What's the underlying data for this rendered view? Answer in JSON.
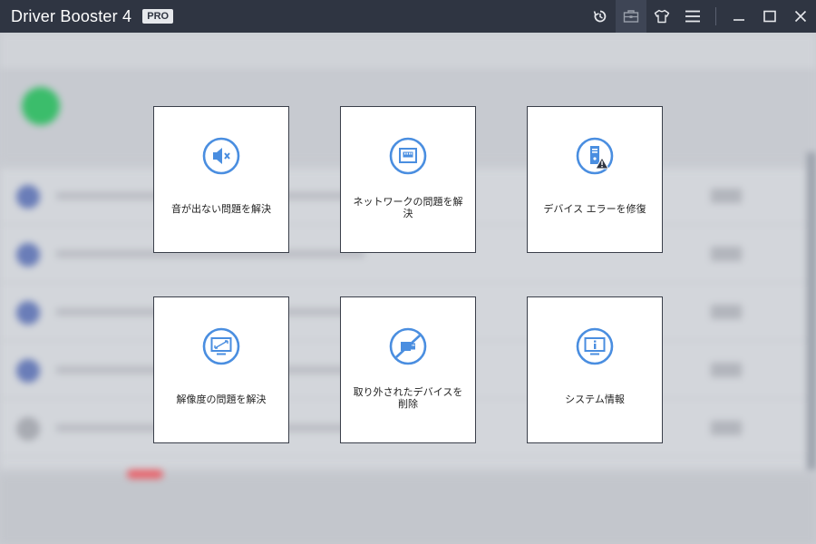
{
  "window": {
    "title": "Driver Booster 4",
    "badge": "PRO"
  },
  "titlebar_icons": [
    "restore-icon",
    "toolbox-icon",
    "skin-icon",
    "menu-icon",
    "minimize-icon",
    "maximize-icon",
    "close-icon"
  ],
  "colors": {
    "accent": "#4a8ee0",
    "titlebar": "#2f3542",
    "card_bg": "#ffffff",
    "warning": "#2f3542"
  },
  "tools": [
    {
      "label": "音が出ない問題を解決",
      "icon": "mute-speaker-icon"
    },
    {
      "label": "ネットワークの問題を解決",
      "icon": "network-port-icon"
    },
    {
      "label": "デバイス エラーを修復",
      "icon": "device-error-icon"
    },
    {
      "label": "解像度の問題を解決",
      "icon": "resolution-monitor-icon"
    },
    {
      "label": "取り外されたデバイスを削除",
      "icon": "removed-device-icon"
    },
    {
      "label": "システム情報",
      "icon": "system-info-icon"
    }
  ]
}
